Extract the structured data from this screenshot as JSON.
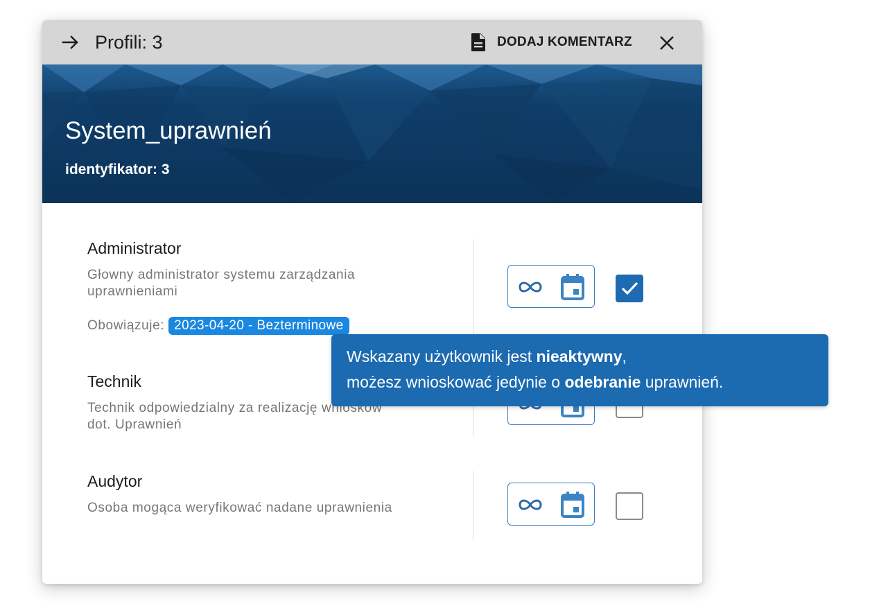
{
  "topbar": {
    "title": "Profili: 3",
    "add_comment_label": "DODAJ KOMENTARZ",
    "back_icon": "arrow-right-icon",
    "comment_icon": "document-icon",
    "close_icon": "close-icon"
  },
  "hero": {
    "title": "System_uprawnień",
    "subtitle": "identyfikator: 3"
  },
  "roles": [
    {
      "name": "Administrator",
      "description": "Głowny administrator systemu zarządzania uprawnieniami",
      "validity_label": "Obowiązuje:",
      "validity_value": "2023-04-20 - Bezterminowe",
      "checked": true
    },
    {
      "name": "Technik",
      "description": "Technik odpowiedzialny za realizację wniosków dot. Uprawnień",
      "checked": false
    },
    {
      "name": "Audytor",
      "description": "Osoba mogąca weryfikować nadane uprawnienia",
      "checked": false
    }
  ],
  "tooltip": {
    "line1_prefix": "Wskazany użytkownik jest ",
    "line1_bold": "nieaktywny",
    "line1_suffix": ",",
    "line2_prefix": "możesz wnioskować jedynie o ",
    "line2_bold": "odebranie",
    "line2_suffix": " uprawnień."
  },
  "colors": {
    "accent": "#1e6bb4",
    "badge": "#1a88e0",
    "hero": "#0c3358",
    "topbar": "#d6d6d6"
  }
}
